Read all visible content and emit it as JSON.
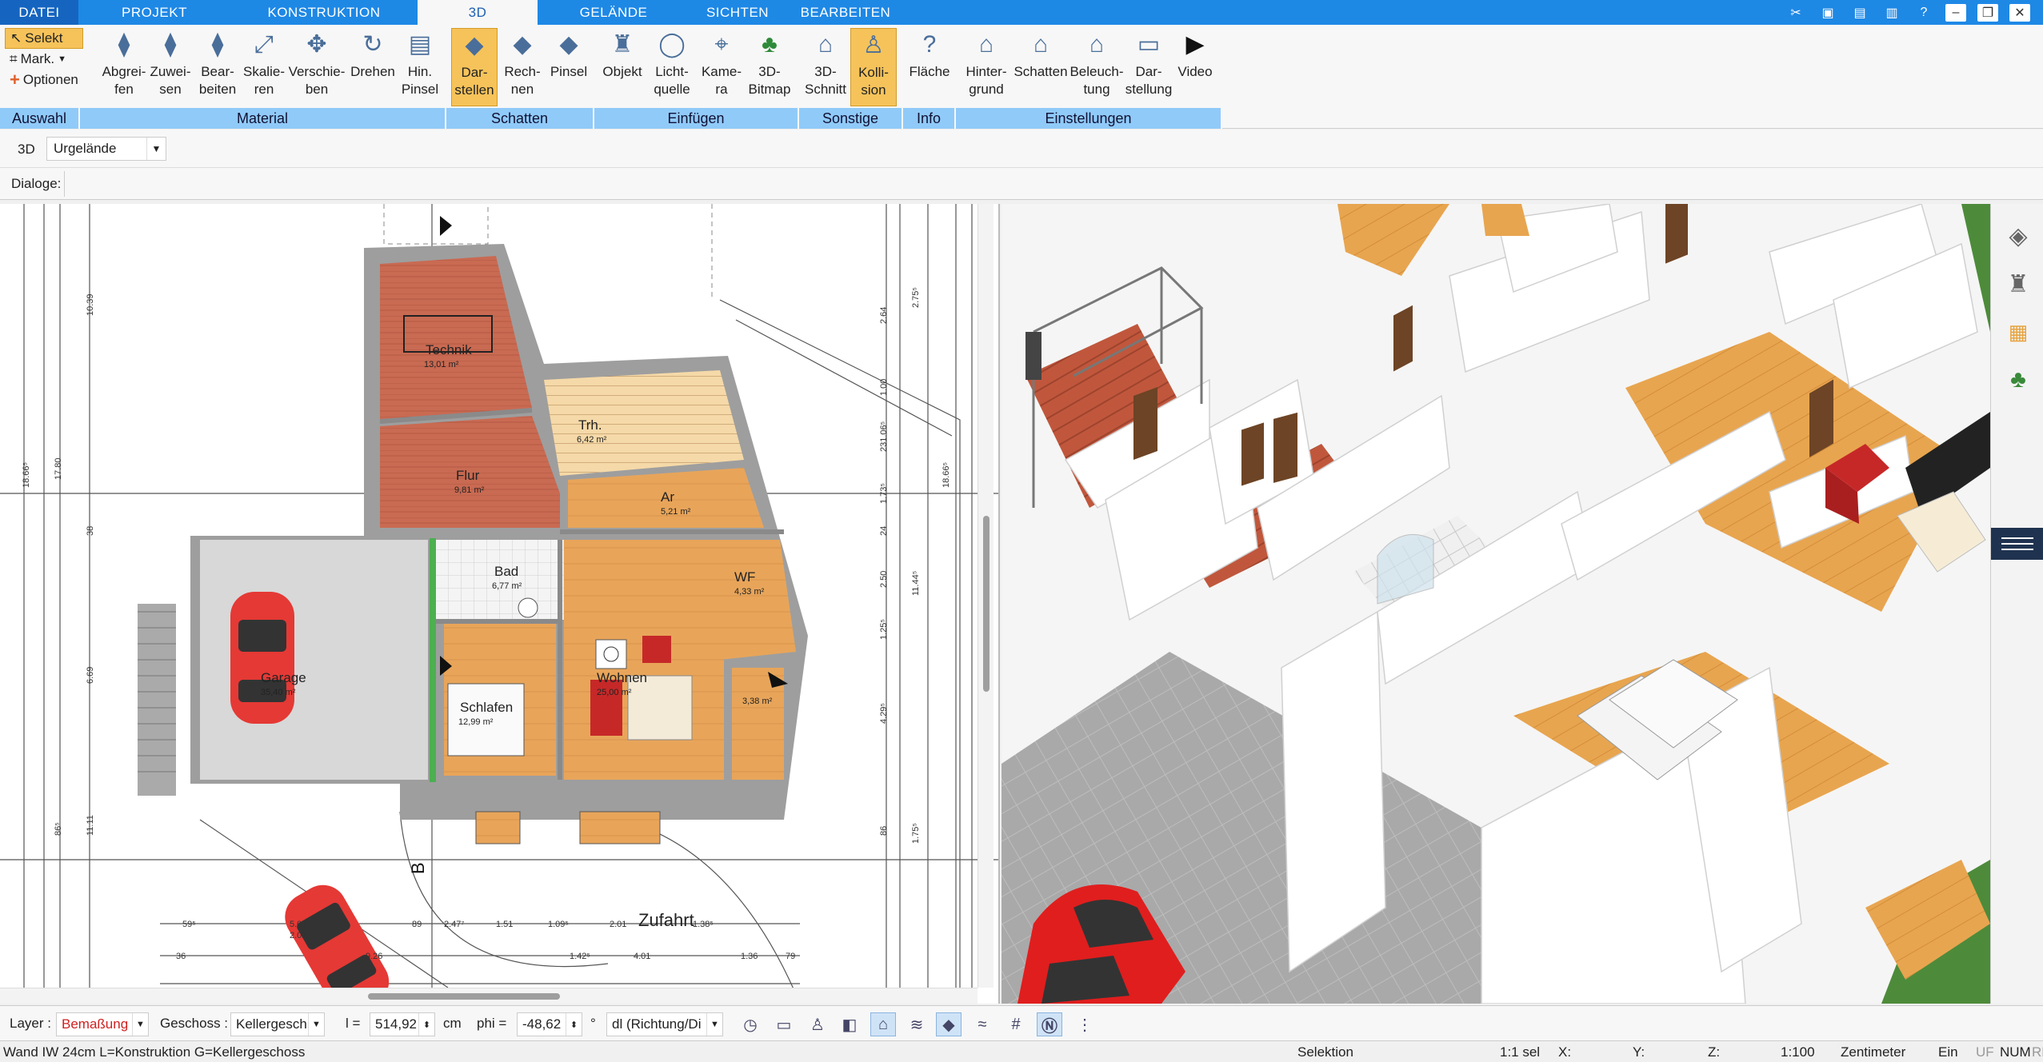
{
  "tabs": [
    {
      "label": "DATEI"
    },
    {
      "label": "PROJEKT"
    },
    {
      "label": "KONSTRUKTION"
    },
    {
      "label": "3D"
    },
    {
      "label": "GELÄNDE"
    },
    {
      "label": "SICHTEN"
    },
    {
      "label": "BEARBEITEN"
    }
  ],
  "ribbon": {
    "auswahl": {
      "label": "Auswahl",
      "selekt": "Selekt",
      "mark": "Mark.",
      "optionen": "Optionen"
    },
    "material": {
      "label": "Material",
      "buttons": [
        "Abgrei-\nfen",
        "Zuwei-\nsen",
        "Bear-\nbeiten",
        "Skalie-\nren",
        "Verschie-\nben",
        "Drehen",
        "Hin.\nPinsel"
      ]
    },
    "schatten": {
      "label": "Schatten",
      "buttons": [
        "Dar-\nstellen",
        "Rech-\nnen",
        "Pinsel"
      ]
    },
    "einfuegen": {
      "label": "Einfügen",
      "buttons": [
        "Objekt",
        "Licht-\nquelle",
        "Kame-\nra",
        "3D-\nBitmap"
      ]
    },
    "sonstige": {
      "label": "Sonstige",
      "buttons": [
        "3D-\nSchnitt",
        "Kolli-\nsion"
      ]
    },
    "info": {
      "label": "Info",
      "buttons": [
        "Fläche"
      ]
    },
    "einstellungen": {
      "label": "Einstellungen",
      "buttons": [
        "Hinter-\ngrund",
        "Schatten",
        "Beleuch-\ntung",
        "Dar-\nstellung",
        "Video"
      ]
    }
  },
  "toolbar2": {
    "mode": "3D",
    "layer_select": "Urgelände",
    "dialoge": "Dialoge:"
  },
  "plan": {
    "rooms": [
      {
        "name": "Technik",
        "area": "13,01 m²"
      },
      {
        "name": "Trh.",
        "area": "6,42 m²"
      },
      {
        "name": "Flur",
        "area": "9,81 m²"
      },
      {
        "name": "Ar",
        "area": "5,21 m²"
      },
      {
        "name": "Bad",
        "area": "6,77 m²"
      },
      {
        "name": "WF",
        "area": "4,33 m²"
      },
      {
        "name": "Garage",
        "area": "35,40 m²"
      },
      {
        "name": "Wohnen",
        "area": "25,00 m²"
      },
      {
        "name": "Schlafen",
        "area": "12,99 m²"
      },
      {
        "name": "",
        "area": "3,38 m²"
      }
    ],
    "section_mark": "B",
    "zufahrt": "Zufahrt",
    "dims_left": [
      "10.39",
      "17.80",
      "18.66⁵",
      "6.69",
      "11.11",
      "86⁵",
      "38"
    ],
    "dims_right": [
      "2.64",
      "2.75⁵",
      "1.00",
      "231.06⁵",
      "1.73⁵",
      "24",
      "2.50",
      "11.44⁵",
      "1.25⁵",
      "4.29⁵",
      "86",
      "1.75⁵",
      "18.66⁵"
    ],
    "dims_bottom1": [
      "59⁵",
      "5.01",
      "89",
      "2.47⁷",
      "1.51",
      "1.09⁵",
      "2.01",
      "1.38⁵"
    ],
    "dims_bottom2": [
      "2.01",
      "9.26",
      "4.01",
      "1.36",
      "79",
      "36",
      "1.42⁵"
    ]
  },
  "options": {
    "layer_label": "Layer :",
    "layer_value": "Bemaßung",
    "geschoss_label": "Geschoss :",
    "geschoss_value": "Kellergesch",
    "l_label": "l =",
    "l_value": "514,92",
    "l_unit": "cm",
    "phi_label": "phi =",
    "phi_value": "-48,62",
    "phi_unit": "°",
    "dl_value": "dl (Richtung/Di"
  },
  "status": {
    "left": "Wand IW 24cm L=Konstruktion G=Kellergeschoss",
    "mode": "Selektion",
    "sel": "1:1 sel",
    "x": "X:",
    "y": "Y:",
    "z": "Z:",
    "scale": "1:100",
    "unit": "Zentimeter",
    "ein": "Ein",
    "uf": "UF",
    "num": "NUM",
    "rf": "RF"
  },
  "colors": {
    "accent": "#1e88e5",
    "ribbon_group": "#90caf9",
    "highlight": "#f6c35a",
    "wood": "#e8a55a",
    "tile_red": "#c96a52"
  }
}
